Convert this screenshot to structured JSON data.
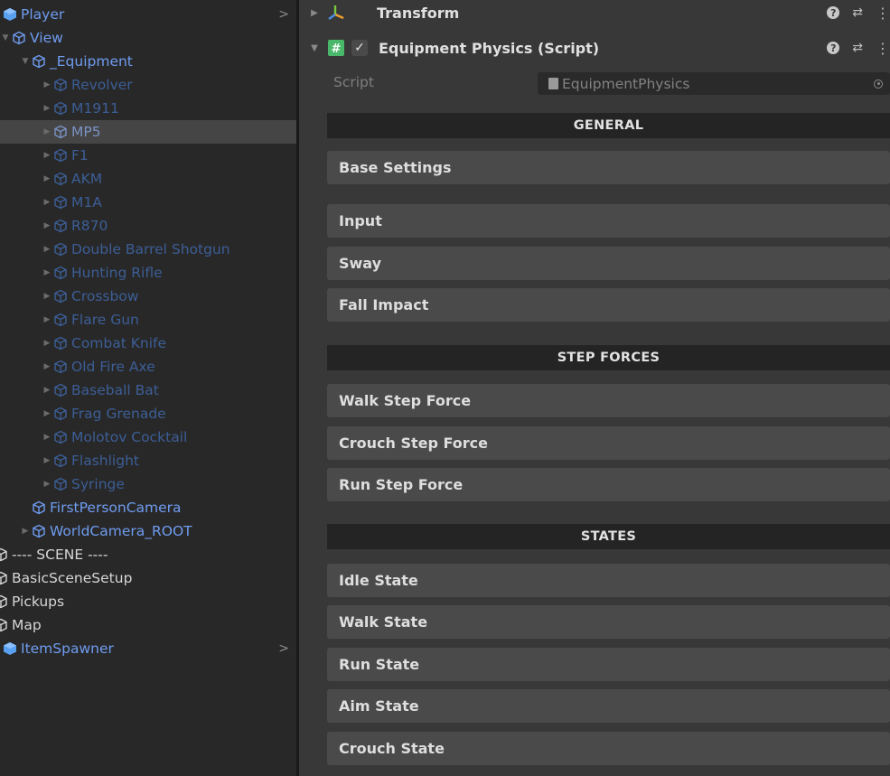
{
  "hierarchy": {
    "items": [
      {
        "label": "Player"
      },
      {
        "label": "View"
      },
      {
        "label": "_Equipment"
      },
      {
        "label": "Revolver"
      },
      {
        "label": "M1911"
      },
      {
        "label": "MP5"
      },
      {
        "label": "F1"
      },
      {
        "label": "AKM"
      },
      {
        "label": "M1A"
      },
      {
        "label": "R870"
      },
      {
        "label": "Double Barrel Shotgun"
      },
      {
        "label": "Hunting Rifle"
      },
      {
        "label": "Crossbow"
      },
      {
        "label": "Flare Gun"
      },
      {
        "label": "Combat Knife"
      },
      {
        "label": "Old Fire Axe"
      },
      {
        "label": "Baseball Bat"
      },
      {
        "label": "Frag Grenade"
      },
      {
        "label": "Molotov Cocktail"
      },
      {
        "label": "Flashlight"
      },
      {
        "label": "Syringe"
      },
      {
        "label": "FirstPersonCamera"
      },
      {
        "label": "WorldCamera_ROOT"
      },
      {
        "label": "---- SCENE ----"
      },
      {
        "label": "BasicSceneSetup"
      },
      {
        "label": "Pickups"
      },
      {
        "label": "Map"
      },
      {
        "label": "ItemSpawner"
      }
    ],
    "chevron": ">"
  },
  "inspector": {
    "transform_title": "Transform",
    "component_title": "Equipment Physics (Script)",
    "script_label": "Script",
    "script_value": "EquipmentPhysics",
    "sections": {
      "general": "GENERAL",
      "step_forces": "STEP FORCES",
      "states": "STATES"
    },
    "foldouts": {
      "base_settings": "Base Settings",
      "input": "Input",
      "sway": "Sway",
      "fall_impact": "Fall Impact",
      "walk_step_force": "Walk Step Force",
      "crouch_step_force": "Crouch Step Force",
      "run_step_force": "Run Step Force",
      "idle_state": "Idle State",
      "walk_state": "Walk State",
      "run_state": "Run State",
      "aim_state": "Aim State",
      "crouch_state": "Crouch State"
    },
    "glyphs": {
      "help": "?",
      "presets": "⇄",
      "menu": "⋮",
      "check": "✓",
      "script_icon": "#"
    }
  },
  "colors": {
    "panel_bg": "#282828",
    "inspector_bg": "#383838",
    "section_bg": "#242424",
    "foldout_bg": "#4a4a4a",
    "prefab_blue": "#6f9cf0",
    "dim_prefab_blue": "#3c5e96"
  }
}
